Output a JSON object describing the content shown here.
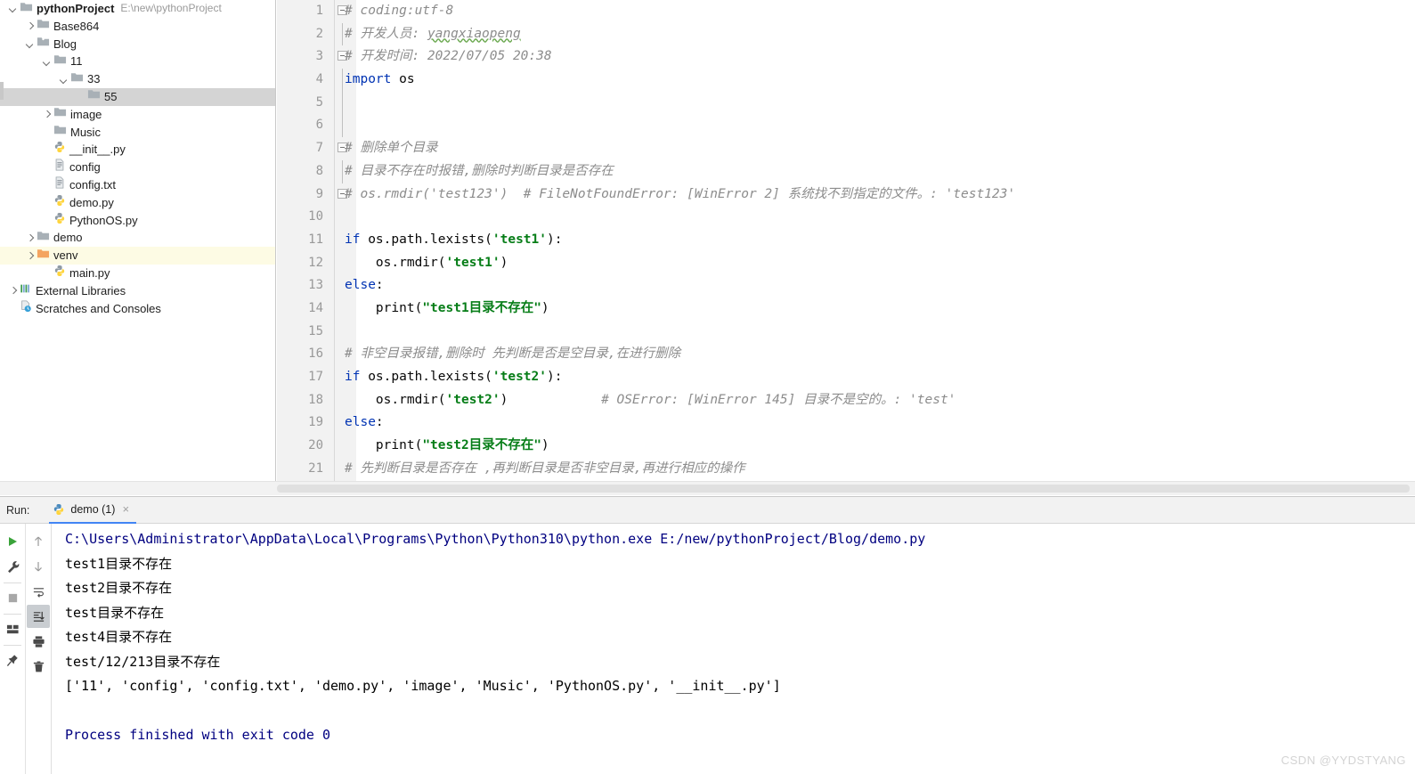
{
  "project_tree": {
    "rows": [
      {
        "indent": 0,
        "arrow": "down",
        "icon": "folder-gray-icon",
        "label": "pythonProject",
        "bold": true,
        "hint": "E:\\new\\pythonProject",
        "state": "none"
      },
      {
        "indent": 1,
        "arrow": "right",
        "icon": "folder-gray-icon",
        "label": "Base864",
        "bold": false,
        "hint": "",
        "state": "none"
      },
      {
        "indent": 1,
        "arrow": "down",
        "icon": "folder-src-icon",
        "label": "Blog",
        "bold": false,
        "hint": "",
        "state": "none"
      },
      {
        "indent": 2,
        "arrow": "down",
        "icon": "folder-gray-icon",
        "label": "11",
        "bold": false,
        "hint": "",
        "state": "none"
      },
      {
        "indent": 3,
        "arrow": "down",
        "icon": "folder-gray-icon",
        "label": "33",
        "bold": false,
        "hint": "",
        "state": "none"
      },
      {
        "indent": 4,
        "arrow": "none",
        "icon": "folder-gray-icon",
        "label": "55",
        "bold": false,
        "hint": "",
        "state": "selected-gray"
      },
      {
        "indent": 2,
        "arrow": "right",
        "icon": "folder-gray-icon",
        "label": "image",
        "bold": false,
        "hint": "",
        "state": "none"
      },
      {
        "indent": 2,
        "arrow": "none",
        "icon": "folder-gray-icon",
        "label": "Music",
        "bold": false,
        "hint": "",
        "state": "none"
      },
      {
        "indent": 2,
        "arrow": "none",
        "icon": "python-file-icon",
        "label": "__init__.py",
        "bold": false,
        "hint": "",
        "state": "none"
      },
      {
        "indent": 2,
        "arrow": "none",
        "icon": "text-file-icon",
        "label": "config",
        "bold": false,
        "hint": "",
        "state": "none"
      },
      {
        "indent": 2,
        "arrow": "none",
        "icon": "text-file-icon",
        "label": "config.txt",
        "bold": false,
        "hint": "",
        "state": "none"
      },
      {
        "indent": 2,
        "arrow": "none",
        "icon": "python-file-icon",
        "label": "demo.py",
        "bold": false,
        "hint": "",
        "state": "none"
      },
      {
        "indent": 2,
        "arrow": "none",
        "icon": "python-file-icon",
        "label": "PythonOS.py",
        "bold": false,
        "hint": "",
        "state": "none"
      },
      {
        "indent": 1,
        "arrow": "right",
        "icon": "folder-gray-icon",
        "label": "demo",
        "bold": false,
        "hint": "",
        "state": "none"
      },
      {
        "indent": 1,
        "arrow": "right",
        "icon": "folder-venv-icon",
        "label": "venv",
        "bold": false,
        "hint": "",
        "state": "highlight-yellow"
      },
      {
        "indent": 2,
        "arrow": "none",
        "icon": "python-file-icon",
        "label": "main.py",
        "bold": false,
        "hint": "",
        "state": "none"
      },
      {
        "indent": 0,
        "arrow": "right",
        "icon": "libraries-icon",
        "label": "External Libraries",
        "bold": false,
        "hint": "",
        "state": "none"
      },
      {
        "indent": 0,
        "arrow": "none",
        "icon": "scratches-icon",
        "label": "Scratches and Consoles",
        "bold": false,
        "hint": "",
        "state": "none"
      }
    ]
  },
  "editor": {
    "lines": [
      {
        "n": "1",
        "fold": "start",
        "tokens": [
          {
            "t": "# coding:utf-8",
            "c": "cmt"
          }
        ]
      },
      {
        "n": "2",
        "fold": "body",
        "tokens": [
          {
            "t": "# ",
            "c": "cmt"
          },
          {
            "t": "开发人员: ",
            "c": "cmt"
          },
          {
            "t": "yangxiaopeng",
            "c": "cmt-grn"
          }
        ]
      },
      {
        "n": "3",
        "fold": "end",
        "tokens": [
          {
            "t": "# 开发时间: 2022/07/05 20:38",
            "c": "cmt"
          }
        ]
      },
      {
        "n": "4",
        "fold": "line",
        "tokens": [
          {
            "t": "import",
            "c": "kw"
          },
          {
            "t": " os",
            "c": "plain"
          }
        ]
      },
      {
        "n": "5",
        "fold": "line",
        "tokens": []
      },
      {
        "n": "6",
        "fold": "line",
        "tokens": []
      },
      {
        "n": "7",
        "fold": "start",
        "tokens": [
          {
            "t": "# 删除单个目录",
            "c": "cmt"
          }
        ]
      },
      {
        "n": "8",
        "fold": "body",
        "tokens": [
          {
            "t": "# 目录不存在时报错,删除时判断目录是否存在",
            "c": "cmt"
          }
        ]
      },
      {
        "n": "9",
        "fold": "end",
        "tokens": [
          {
            "t": "# os.rmdir('test123')  # FileNotFoundError: [WinError 2] 系统找不到指定的文件。: 'test123'",
            "c": "cmt"
          }
        ]
      },
      {
        "n": "10",
        "fold": "none",
        "tokens": []
      },
      {
        "n": "11",
        "fold": "none",
        "tokens": [
          {
            "t": "if",
            "c": "kw"
          },
          {
            "t": " os.path.lexists(",
            "c": "plain"
          },
          {
            "t": "'test1'",
            "c": "str"
          },
          {
            "t": "):",
            "c": "plain"
          }
        ]
      },
      {
        "n": "12",
        "fold": "none",
        "tokens": [
          {
            "t": "    os.rmdir(",
            "c": "plain"
          },
          {
            "t": "'test1'",
            "c": "str"
          },
          {
            "t": ")",
            "c": "plain"
          }
        ]
      },
      {
        "n": "13",
        "fold": "none",
        "tokens": [
          {
            "t": "else",
            "c": "kw"
          },
          {
            "t": ":",
            "c": "plain"
          }
        ]
      },
      {
        "n": "14",
        "fold": "none",
        "tokens": [
          {
            "t": "    print(",
            "c": "plain"
          },
          {
            "t": "\"test1目录不存在\"",
            "c": "str"
          },
          {
            "t": ")",
            "c": "plain"
          }
        ]
      },
      {
        "n": "15",
        "fold": "none",
        "tokens": []
      },
      {
        "n": "16",
        "fold": "none",
        "tokens": [
          {
            "t": "# 非空目录报错,删除时 先判断是否是空目录,在进行删除",
            "c": "cmt"
          }
        ]
      },
      {
        "n": "17",
        "fold": "none",
        "tokens": [
          {
            "t": "if",
            "c": "kw"
          },
          {
            "t": " os.path.lexists(",
            "c": "plain"
          },
          {
            "t": "'test2'",
            "c": "str"
          },
          {
            "t": "):",
            "c": "plain"
          }
        ]
      },
      {
        "n": "18",
        "fold": "none",
        "tokens": [
          {
            "t": "    os.rmdir(",
            "c": "plain"
          },
          {
            "t": "'test2'",
            "c": "str"
          },
          {
            "t": ")",
            "c": "plain"
          },
          {
            "t": "            # OSError: [WinError 145] 目录不是空的。: 'test'",
            "c": "cmt"
          }
        ]
      },
      {
        "n": "19",
        "fold": "none",
        "tokens": [
          {
            "t": "else",
            "c": "kw"
          },
          {
            "t": ":",
            "c": "plain"
          }
        ]
      },
      {
        "n": "20",
        "fold": "none",
        "tokens": [
          {
            "t": "    print(",
            "c": "plain"
          },
          {
            "t": "\"test2目录不存在\"",
            "c": "str"
          },
          {
            "t": ")",
            "c": "plain"
          }
        ]
      },
      {
        "n": "21",
        "fold": "none",
        "tokens": [
          {
            "t": "# 先判断目录是否存在 ,再判断目录是否非空目录,再进行相应的操作",
            "c": "cmt"
          }
        ]
      }
    ]
  },
  "run_panel": {
    "run_label": "Run:",
    "tab": {
      "icon": "python-file-icon",
      "label": "demo (1)",
      "close": "×"
    },
    "toolbar_left": [
      {
        "name": "rerun-button",
        "icon": "play-icon"
      },
      {
        "name": "edit-config-button",
        "icon": "wrench-icon"
      },
      {
        "name": "stop-button",
        "icon": "stop-square-icon"
      },
      {
        "name": "layout-button",
        "icon": "layout-icon"
      },
      {
        "name": "pin-tab-button",
        "icon": "pin-icon"
      }
    ],
    "toolbar_right": [
      {
        "name": "prev-occurrence-button",
        "icon": "arrow-up-icon"
      },
      {
        "name": "next-occurrence-button",
        "icon": "arrow-down-icon"
      },
      {
        "name": "soft-wrap-button",
        "icon": "wrap-text-icon"
      },
      {
        "name": "scroll-to-end-button",
        "icon": "scroll-end-icon",
        "active": true
      },
      {
        "name": "print-button",
        "icon": "printer-icon"
      },
      {
        "name": "clear-all-button",
        "icon": "trash-icon"
      }
    ],
    "console_lines": [
      {
        "text": "C:\\Users\\Administrator\\AppData\\Local\\Programs\\Python\\Python310\\python.exe E:/new/pythonProject/Blog/demo.py",
        "color": "blue"
      },
      {
        "text": "test1目录不存在",
        "color": "black"
      },
      {
        "text": "test2目录不存在",
        "color": "black"
      },
      {
        "text": "test目录不存在",
        "color": "black"
      },
      {
        "text": "test4目录不存在",
        "color": "black"
      },
      {
        "text": "test/12/213目录不存在",
        "color": "black"
      },
      {
        "text": "['11', 'config', 'config.txt', 'demo.py', 'image', 'Music', 'PythonOS.py', '__init__.py']",
        "color": "black"
      },
      {
        "text": "",
        "color": "black"
      },
      {
        "text": "Process finished with exit code 0",
        "color": "blue"
      }
    ]
  },
  "watermark": {
    "text": "CSDN @YYDSTYANG"
  },
  "colors": {
    "keyword": "#0033b3",
    "string": "#067d17",
    "comment": "#8c8c8c",
    "console_blue": "#000080",
    "tab_underline": "#4285f4",
    "selection_gray": "#d4d4d4",
    "highlight_yellow": "#fdfbe4",
    "venv_folder_orange": "#f4a460"
  }
}
